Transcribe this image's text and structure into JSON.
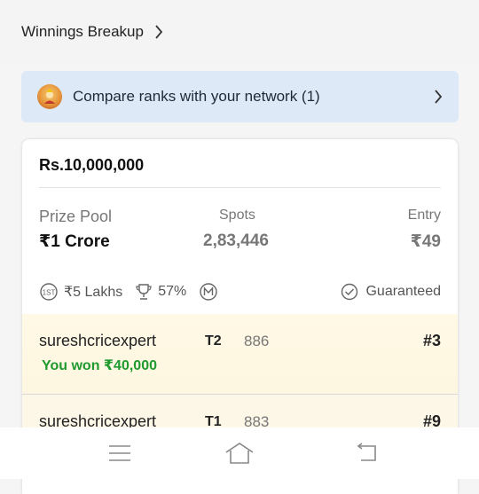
{
  "header": {
    "winnings_label": "Winnings Breakup",
    "winnings_icon": "chevron-right-icon"
  },
  "compare": {
    "label": "Compare ranks with your network (1)",
    "icon": "chevron-right-icon",
    "background": "#dde9f6"
  },
  "contest": {
    "prize_amount": "Rs.10,000,000",
    "prize_pool_label": "Prize Pool",
    "prize_pool_value": "₹1 Crore",
    "spots_label": "Spots",
    "spots_value": "2,83,446",
    "entry_label": "Entry",
    "entry_value": "₹49",
    "first_prize": "₹5 Lakhs",
    "win_percent": "57%",
    "guaranteed_label": "Guaranteed"
  },
  "leaderboard": [
    {
      "username": "sureshcricexpert",
      "winning": "You won ₹40,000",
      "team": "T2",
      "points": "886",
      "rank": "#3"
    },
    {
      "username": "sureshcricexpert",
      "team": "T1",
      "points": "883",
      "rank": "#9"
    }
  ],
  "colors": {
    "win_green": "#1f9a2e",
    "highlight_row": "#fff9e6"
  },
  "navbar": {
    "menu_icon": "menu-icon",
    "home_icon": "home-icon",
    "back_icon": "back-icon"
  }
}
